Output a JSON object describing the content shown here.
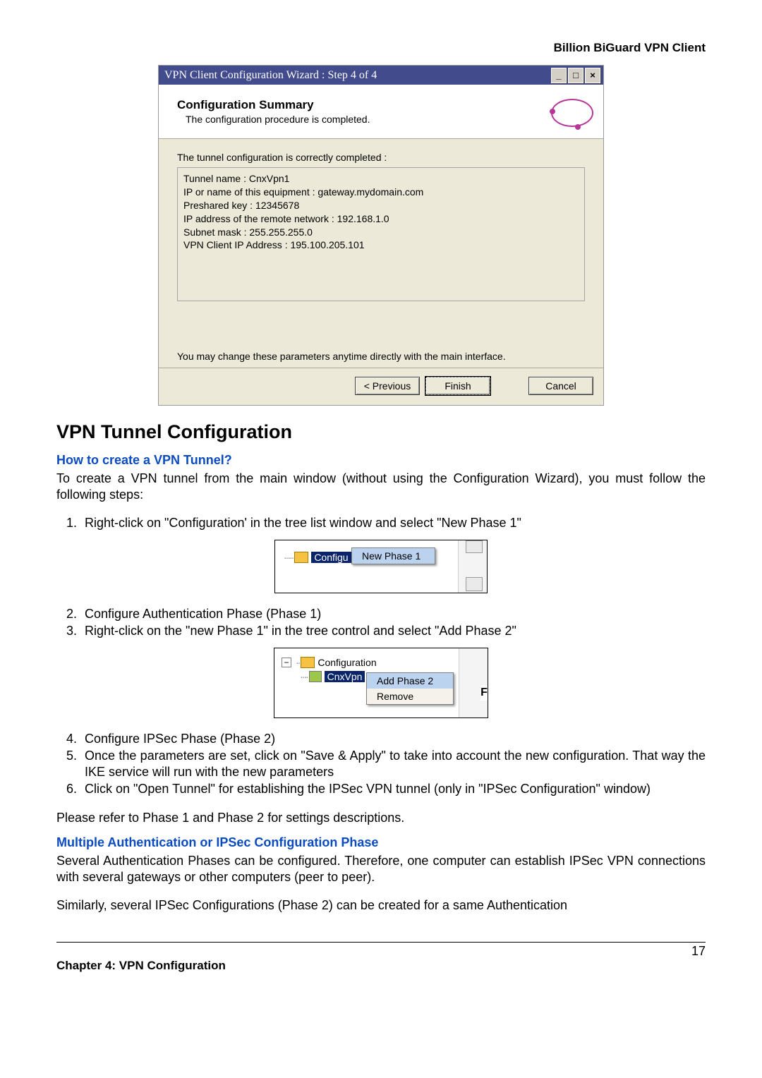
{
  "header": {
    "right": "Billion BiGuard VPN Client"
  },
  "wizard": {
    "title": "VPN Client Configuration Wizard : Step 4 of 4",
    "heading": "Configuration Summary",
    "subheading": "The configuration procedure is completed.",
    "body": {
      "tunnel_ok": "The tunnel configuration is correctly completed :",
      "details": {
        "l1": "Tunnel name : CnxVpn1",
        "l2": "IP or name of this equipment : gateway.mydomain.com",
        "l3": "Preshared key : 12345678",
        "l4": "IP address of the remote network : 192.168.1.0",
        "l5": "Subnet mask : 255.255.255.0",
        "l6": "VPN Client IP Address : 195.100.205.101"
      },
      "note": "You may change these parameters anytime directly with the main interface."
    },
    "buttons": {
      "prev": "< Previous",
      "finish": "Finish",
      "cancel": "Cancel"
    }
  },
  "sections": {
    "h1": "VPN Tunnel Configuration",
    "sub1": "How to create a VPN Tunnel?",
    "intro": "To create a VPN tunnel from the main window (without using the Configuration Wizard), you must follow the following steps:",
    "steps": {
      "s1": "Right-click on \"Configuration' in the tree list window and select \"New Phase 1\"",
      "s2": "Configure Authentication Phase (Phase 1)",
      "s3": "Right-click on the \"new Phase 1\" in the tree control and select \"Add Phase 2\"",
      "s4": "Configure IPSec Phase (Phase 2)",
      "s5": "Once the parameters are set, click on \"Save & Apply\" to take into account the new configuration. That way the IKE service will run with the new parameters",
      "s6": "Click on \"Open Tunnel\" for establishing the IPSec VPN tunnel (only in \"IPSec Configuration\" window)"
    },
    "closing": "Please refer to Phase 1 and Phase 2 for settings descriptions.",
    "sub2": "Multiple Authentication or IPSec Configuration Phase",
    "p2a": "Several Authentication Phases can be configured. Therefore, one computer can establish IPSec VPN connections with several gateways or other computers (peer to peer).",
    "p2b": "Similarly, several IPSec Configurations (Phase 2) can be created for a same Authentication"
  },
  "menus": {
    "m1": {
      "tree_label": "Configu",
      "item": "New Phase 1"
    },
    "m2": {
      "top": "Configuration",
      "child": "CnxVpn",
      "item1": "Add Phase 2",
      "item2": "Remove",
      "edge": "F"
    }
  },
  "footer": {
    "pagenum": "17",
    "chapter": "Chapter 4: VPN Configuration"
  }
}
